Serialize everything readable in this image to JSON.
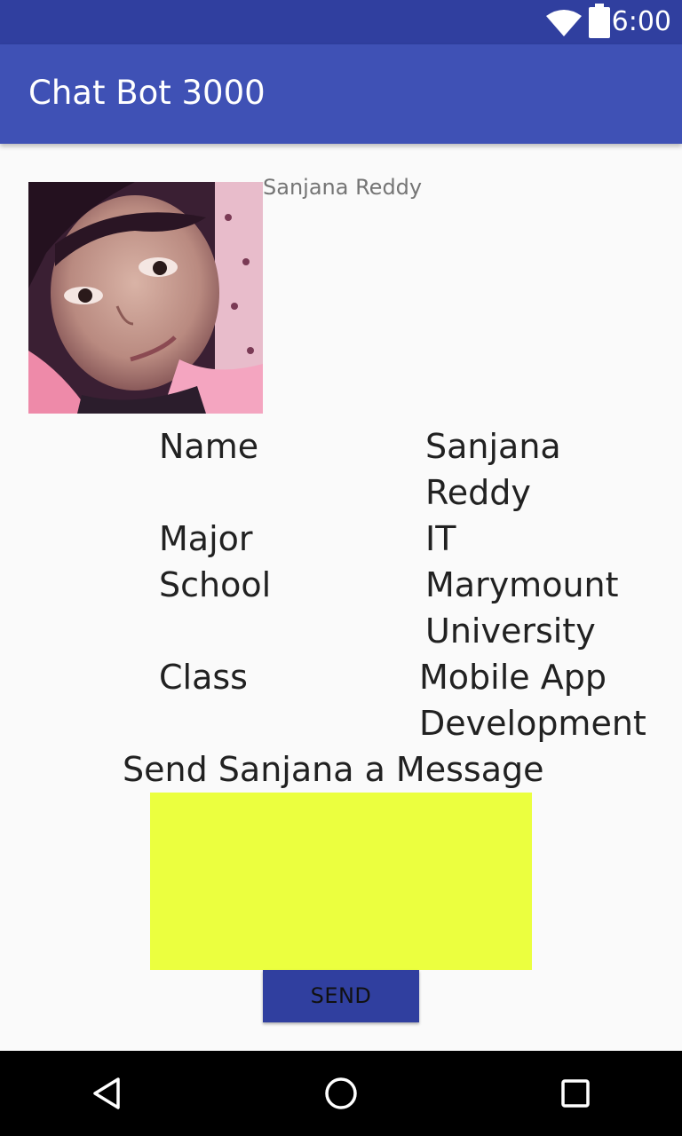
{
  "status_bar": {
    "time": "6:00",
    "icons": [
      "wifi-icon",
      "battery-icon"
    ]
  },
  "app_bar": {
    "title": "Chat Bot 3000",
    "color": "#3f51b5"
  },
  "profile": {
    "photo_caption": "Sanjana Reddy",
    "rows": [
      {
        "label": "Name",
        "value": "Sanjana\nReddy"
      },
      {
        "label": "Major",
        "value": "IT"
      },
      {
        "label": "School",
        "value": "Marymount\nUniversity"
      },
      {
        "label": "Class",
        "value": "Mobile App\nDevelopment"
      }
    ]
  },
  "message": {
    "heading": "Send Sanjana a Message",
    "input_value": "",
    "input_color": "#ebff3f",
    "send_label": "SEND"
  },
  "nav_bar": {
    "icons": [
      "back-icon",
      "home-icon",
      "recents-icon"
    ]
  }
}
